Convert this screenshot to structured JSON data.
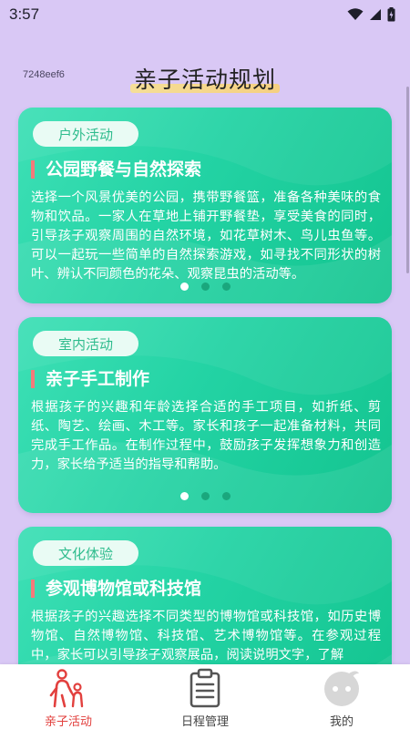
{
  "status": {
    "time": "3:57"
  },
  "header": {
    "build_id": "7248eef6",
    "title": "亲子活动规划"
  },
  "cards": [
    {
      "tag": "户外活动",
      "title": "公园野餐与自然探索",
      "body": "选择一个风景优美的公园，携带野餐篮，准备各种美味的食物和饮品。一家人在草地上铺开野餐垫，享受美食的同时，引导孩子观察周围的自然环境，如花草树木、鸟儿虫鱼等。可以一起玩一些简单的自然探索游戏，如寻找不同形状的树叶、辨认不同颜色的花朵、观察昆虫的活动等。",
      "active_dot": 0
    },
    {
      "tag": "室内活动",
      "title": "亲子手工制作",
      "body": "根据孩子的兴趣和年龄选择合适的手工项目，如折纸、剪纸、陶艺、绘画、木工等。家长和孩子一起准备材料，共同完成手工作品。在制作过程中，鼓励孩子发挥想象力和创造力，家长给予适当的指导和帮助。",
      "active_dot": 0
    },
    {
      "tag": "文化体验",
      "title": "参观博物馆或科技馆",
      "body": "根据孩子的兴趣选择不同类型的博物馆或科技馆，如历史博物馆、自然博物馆、科技馆、艺术博物馆等。在参观过程中，家长可以引导孩子观察展品，阅读说明文字，了解",
      "active_dot": 0
    }
  ],
  "tabs": [
    {
      "label": "亲子活动",
      "icon": "family-icon",
      "active": true
    },
    {
      "label": "日程管理",
      "icon": "clipboard-icon",
      "active": false
    },
    {
      "label": "我的",
      "icon": "profile-face-icon",
      "active": false
    }
  ],
  "colors": {
    "background": "#d9c8f5",
    "card_green": "#23d3a4",
    "tag_text": "#2ebc8d",
    "title_bar": "#f47a7a",
    "active_tab": "#e2403e"
  }
}
